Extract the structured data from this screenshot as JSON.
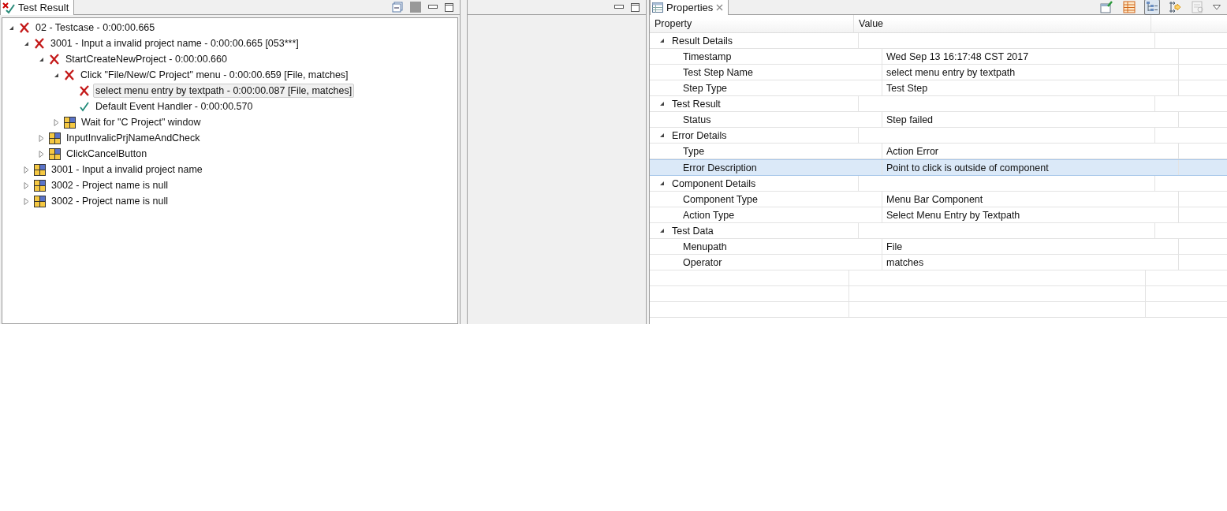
{
  "test_result": {
    "title": "Test Result",
    "tree": [
      {
        "label": "02 - Testcase - 0:00:00.665",
        "kind": "failed",
        "expanded": true,
        "selected": false,
        "children": [
          {
            "label": "3001 - Input a invalid project name - 0:00:00.665 [053***]",
            "kind": "failed",
            "expanded": true,
            "selected": false,
            "children": [
              {
                "label": "StartCreateNewProject - 0:00:00.660",
                "kind": "failed",
                "expanded": true,
                "selected": false,
                "children": [
                  {
                    "label": "Click \"File/New/C Project\" menu - 0:00:00.659 [File, matches]",
                    "kind": "failed",
                    "expanded": true,
                    "selected": false,
                    "children": [
                      {
                        "label": "select menu entry by textpath - 0:00:00.087 [File, matches]",
                        "kind": "failed",
                        "selected": true
                      },
                      {
                        "label": "Default Event Handler - 0:00:00.570",
                        "kind": "passed",
                        "selected": false
                      }
                    ]
                  },
                  {
                    "label": "Wait for \"C Project\" window",
                    "kind": "pending",
                    "expanded": false,
                    "selected": false
                  }
                ]
              },
              {
                "label": "InputInvalicPrjNameAndCheck",
                "kind": "pending",
                "expanded": false,
                "selected": false
              },
              {
                "label": "ClickCancelButton",
                "kind": "pending",
                "expanded": false,
                "selected": false
              }
            ]
          },
          {
            "label": "3001 - Input a invalid project name",
            "kind": "pending",
            "expanded": false,
            "selected": false
          },
          {
            "label": "3002 - Project name is null",
            "kind": "pending",
            "expanded": false,
            "selected": false
          },
          {
            "label": "3002 - Project name is null",
            "kind": "pending",
            "expanded": false,
            "selected": false
          }
        ]
      }
    ]
  },
  "properties": {
    "title": "Properties",
    "toolbar": [
      {
        "kind": "pin",
        "selected": false
      },
      {
        "kind": "table",
        "selected": false
      },
      {
        "kind": "categories",
        "selected": true
      },
      {
        "kind": "advanced",
        "selected": false
      },
      {
        "kind": "restore",
        "selected": false
      }
    ],
    "columns": [
      "Property",
      "Value"
    ],
    "categories": [
      {
        "name": "Result Details",
        "expanded": true,
        "rows": [
          {
            "property": "Timestamp",
            "value": "Wed Sep 13 16:17:48 CST 2017",
            "selected": false
          },
          {
            "property": "Test Step Name",
            "value": "select menu entry by textpath",
            "selected": false
          },
          {
            "property": "Step Type",
            "value": "Test Step",
            "selected": false
          }
        ]
      },
      {
        "name": "Test Result",
        "expanded": true,
        "rows": [
          {
            "property": "Status",
            "value": "Step failed",
            "selected": false
          }
        ]
      },
      {
        "name": "Error Details",
        "expanded": true,
        "rows": [
          {
            "property": "Type",
            "value": "Action Error",
            "selected": false
          },
          {
            "property": "Error Description",
            "value": "Point to click is outside of component",
            "selected": true
          }
        ]
      },
      {
        "name": "Component Details",
        "expanded": true,
        "rows": [
          {
            "property": "Component Type",
            "value": "Menu Bar Component",
            "selected": false
          },
          {
            "property": "Action Type",
            "value": "Select Menu Entry by Textpath",
            "selected": false
          }
        ]
      },
      {
        "name": "Test Data",
        "expanded": true,
        "rows": [
          {
            "property": "Menupath",
            "value": "File",
            "selected": false
          },
          {
            "property": "Operator",
            "value": "matches",
            "selected": false
          }
        ]
      }
    ]
  }
}
